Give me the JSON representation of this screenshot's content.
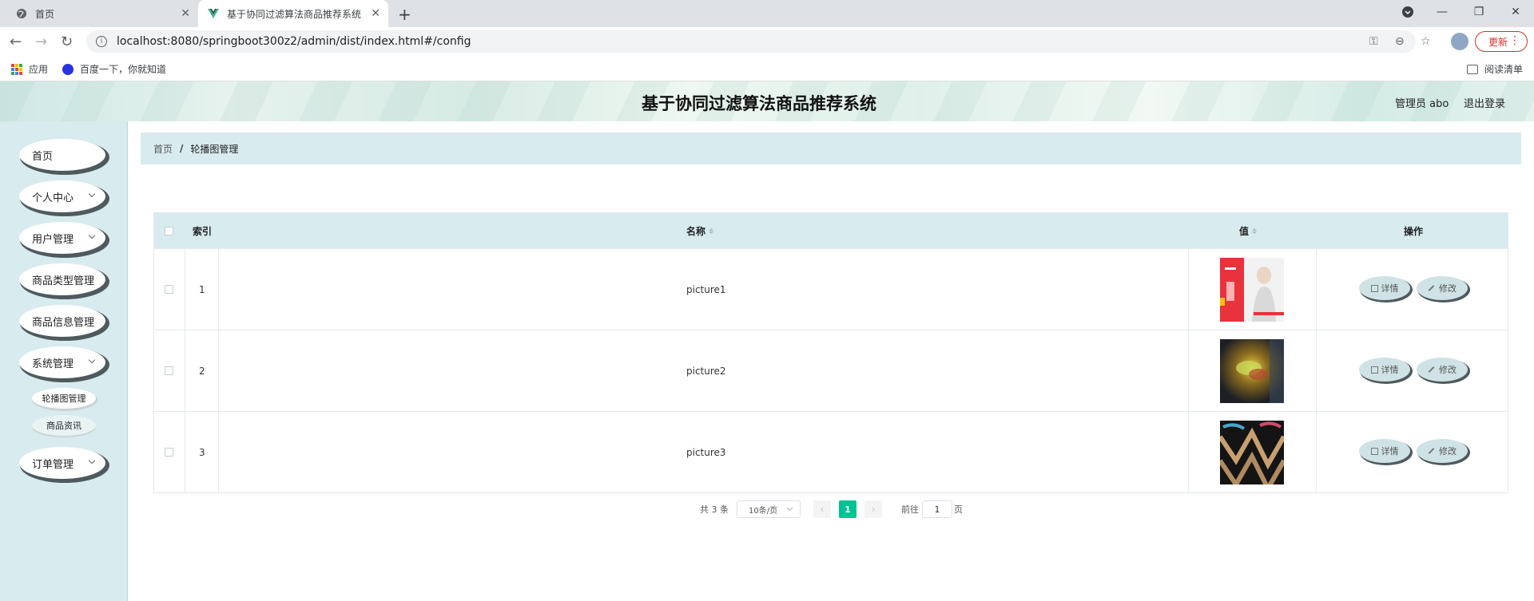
{
  "browser": {
    "tabs": [
      {
        "title": "首页"
      },
      {
        "title": "基于协同过滤算法商品推荐系统"
      }
    ],
    "url": "localhost:8080/springboot300z2/admin/dist/index.html#/config",
    "update_label": "更新",
    "bookmarks": [
      {
        "label": "应用"
      },
      {
        "label": "百度一下，你就知道"
      }
    ],
    "reading_list": "阅读清单"
  },
  "header": {
    "title": "基于协同过滤算法商品推荐系统",
    "user": "管理员 abo",
    "logout": "退出登录"
  },
  "sidebar": {
    "items": [
      {
        "label": "首页",
        "has_children": false
      },
      {
        "label": "个人中心",
        "has_children": true
      },
      {
        "label": "用户管理",
        "has_children": true
      },
      {
        "label": "商品类型管理",
        "has_children": true
      },
      {
        "label": "商品信息管理",
        "has_children": true
      },
      {
        "label": "系统管理",
        "has_children": true
      },
      {
        "label": "订单管理",
        "has_children": true
      }
    ],
    "sub_items": [
      {
        "label": "轮播图管理",
        "active": true
      },
      {
        "label": "商品资讯",
        "active": false
      }
    ]
  },
  "breadcrumb": {
    "home": "首页",
    "separator": "/",
    "current": "轮播图管理"
  },
  "table": {
    "columns": [
      "索引",
      "名称",
      "值",
      "操作"
    ],
    "rows": [
      {
        "index": "1",
        "name": "picture1",
        "image": "red-fashion-banner"
      },
      {
        "index": "2",
        "name": "picture2",
        "image": "dark-food-photo"
      },
      {
        "index": "3",
        "name": "picture3",
        "image": "dark-pattern-photo"
      }
    ],
    "actions": {
      "detail": "详情",
      "edit": "修改"
    }
  },
  "pagination": {
    "total_text": "共 3 条",
    "page_size": "10条/页",
    "current_page": "1",
    "goto_label": "前往",
    "goto_value": "1",
    "page_suffix": "页"
  },
  "colors": {
    "accent": "#00c292",
    "panel": "#d8ebee",
    "update_red": "#d93025"
  }
}
